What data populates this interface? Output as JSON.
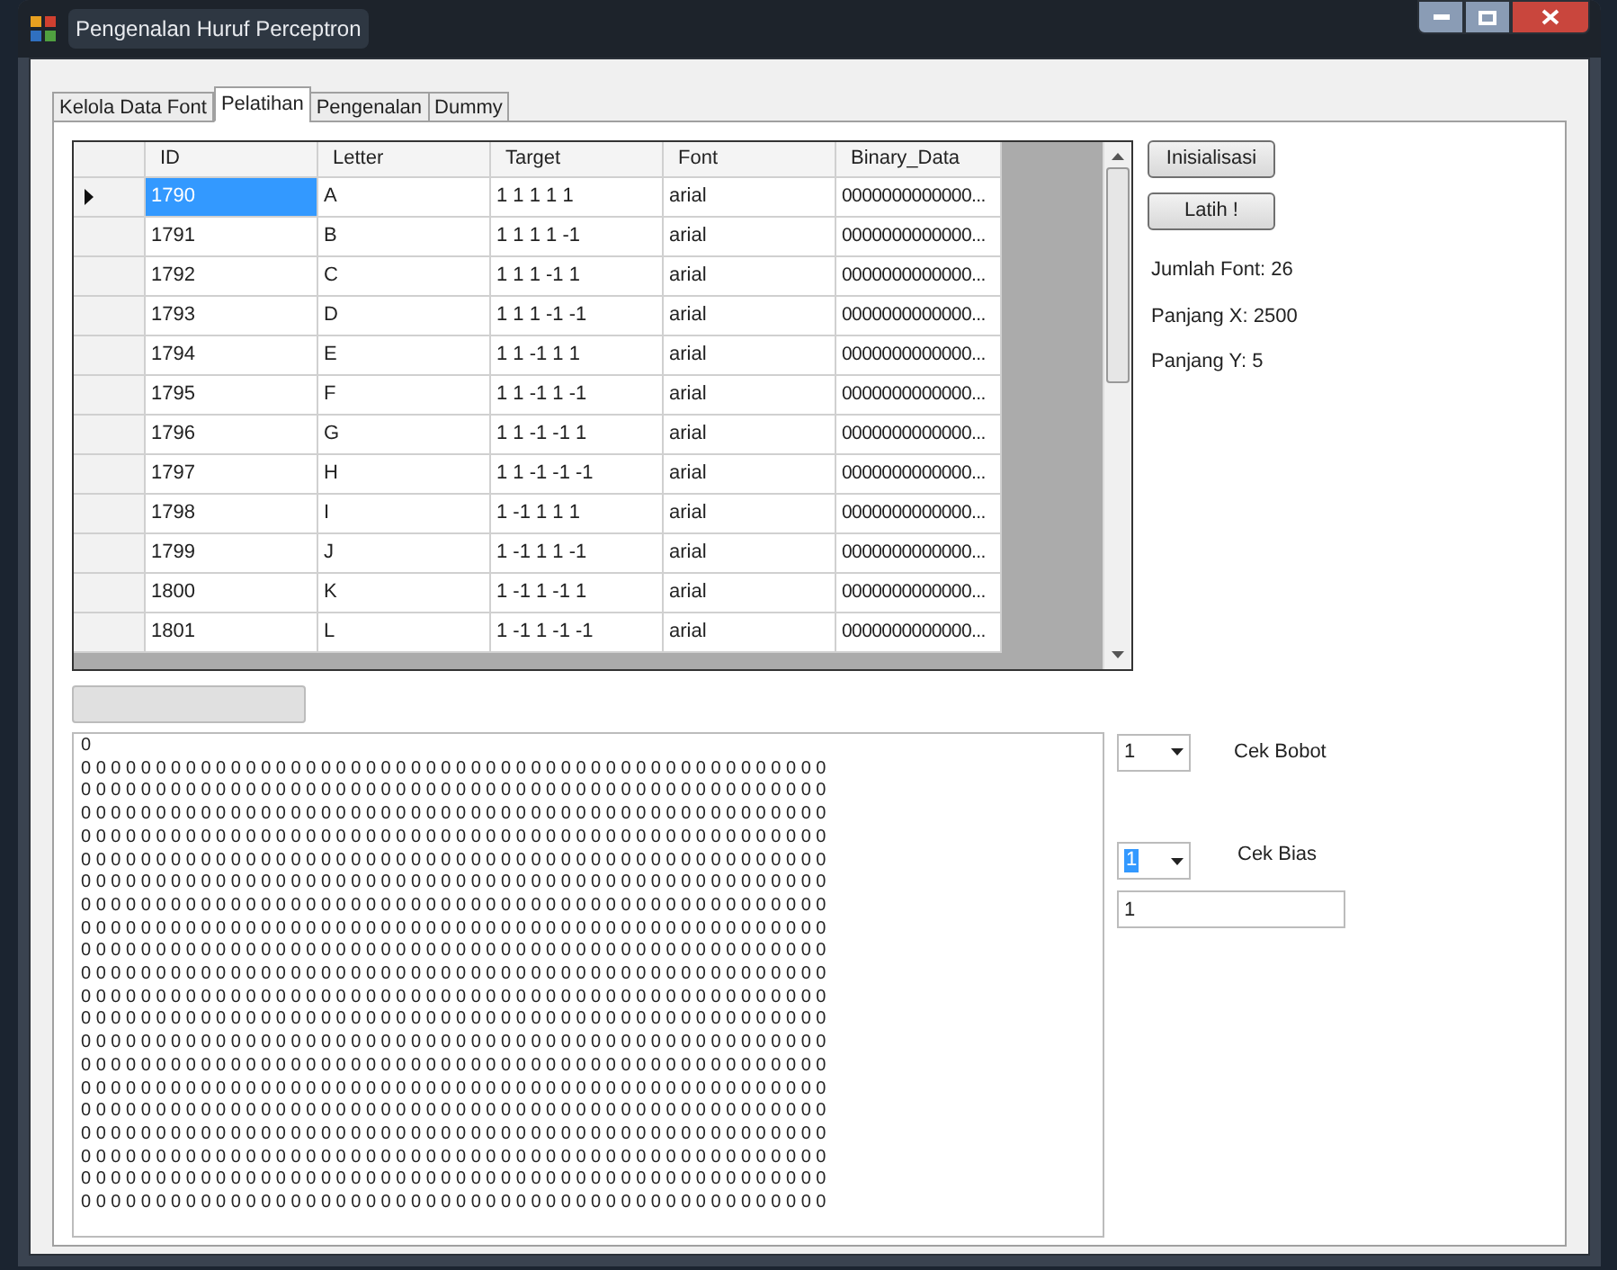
{
  "window": {
    "title": "Pengenalan Huruf Perceptron"
  },
  "tabs": [
    {
      "label": "Kelola Data Font",
      "selected": false
    },
    {
      "label": "Pelatihan",
      "selected": true
    },
    {
      "label": "Pengenalan",
      "selected": false
    },
    {
      "label": "Dummy",
      "selected": false
    }
  ],
  "grid": {
    "columns": [
      "ID",
      "Letter",
      "Target",
      "Font",
      "Binary_Data"
    ],
    "rows": [
      {
        "cells": [
          "1790",
          "A",
          "1 1 1 1 1",
          "arial",
          "0000000000000..."
        ],
        "selected": true
      },
      {
        "cells": [
          "1791",
          "B",
          "1 1 1 1 -1",
          "arial",
          "0000000000000..."
        ],
        "selected": false
      },
      {
        "cells": [
          "1792",
          "C",
          "1 1 1 -1 1",
          "arial",
          "0000000000000..."
        ],
        "selected": false
      },
      {
        "cells": [
          "1793",
          "D",
          "1 1 1 -1 -1",
          "arial",
          "0000000000000..."
        ],
        "selected": false
      },
      {
        "cells": [
          "1794",
          "E",
          "1 1 -1 1 1",
          "arial",
          "0000000000000..."
        ],
        "selected": false
      },
      {
        "cells": [
          "1795",
          "F",
          "1 1 -1 1 -1",
          "arial",
          "0000000000000..."
        ],
        "selected": false
      },
      {
        "cells": [
          "1796",
          "G",
          "1 1 -1 -1 1",
          "arial",
          "0000000000000..."
        ],
        "selected": false
      },
      {
        "cells": [
          "1797",
          "H",
          "1 1 -1 -1 -1",
          "arial",
          "0000000000000..."
        ],
        "selected": false
      },
      {
        "cells": [
          "1798",
          "I",
          "1 -1 1 1 1",
          "arial",
          "0000000000000..."
        ],
        "selected": false
      },
      {
        "cells": [
          "1799",
          "J",
          "1 -1 1 1 -1",
          "arial",
          "0000000000000..."
        ],
        "selected": false
      },
      {
        "cells": [
          "1800",
          "K",
          "1 -1 1 -1 1",
          "arial",
          "0000000000000..."
        ],
        "selected": false
      },
      {
        "cells": [
          "1801",
          "L",
          "1 -1 1 -1 -1",
          "arial",
          "0000000000000..."
        ],
        "selected": false
      }
    ]
  },
  "buttons": [
    "Inisialisasi",
    "Latih !"
  ],
  "info": [
    "Jumlah Font: 26",
    "Panjang X: 2500",
    "Panjang Y: 5"
  ],
  "progress": {
    "level": 0
  },
  "output": {
    "lines": [
      "0",
      "0 0 0 0 0 0 0 0 0 0 0 0 0 0 0 0 0 0 0 0 0 0 0 0 0 0 0 0 0 0 0 0 0 0 0 0 0 0 0 0 0 0 0 0 0 0 0 0 0 0",
      "0 0 0 0 0 0 0 0 0 0 0 0 0 0 0 0 0 0 0 0 0 0 0 0 0 0 0 0 0 0 0 0 0 0 0 0 0 0 0 0 0 0 0 0 0 0 0 0 0 0",
      "0 0 0 0 0 0 0 0 0 0 0 0 0 0 0 0 0 0 0 0 0 0 0 0 0 0 0 0 0 0 0 0 0 0 0 0 0 0 0 0 0 0 0 0 0 0 0 0 0 0",
      "0 0 0 0 0 0 0 0 0 0 0 0 0 0 0 0 0 0 0 0 0 0 0 0 0 0 0 0 0 0 0 0 0 0 0 0 0 0 0 0 0 0 0 0 0 0 0 0 0 0",
      "0 0 0 0 0 0 0 0 0 0 0 0 0 0 0 0 0 0 0 0 0 0 0 0 0 0 0 0 0 0 0 0 0 0 0 0 0 0 0 0 0 0 0 0 0 0 0 0 0 0",
      "0 0 0 0 0 0 0 0 0 0 0 0 0 0 0 0 0 0 0 0 0 0 0 0 0 0 0 0 0 0 0 0 0 0 0 0 0 0 0 0 0 0 0 0 0 0 0 0 0 0",
      "0 0 0 0 0 0 0 0 0 0 0 0 0 0 0 0 0 0 0 0 0 0 0 0 0 0 0 0 0 0 0 0 0 0 0 0 0 0 0 0 0 0 0 0 0 0 0 0 0 0",
      "0 0 0 0 0 0 0 0 0 0 0 0 0 0 0 0 0 0 0 0 0 0 0 0 0 0 0 0 0 0 0 0 0 0 0 0 0 0 0 0 0 0 0 0 0 0 0 0 0 0",
      "0 0 0 0 0 0 0 0 0 0 0 0 0 0 0 0 0 0 0 0 0 0 0 0 0 0 0 0 0 0 0 0 0 0 0 0 0 0 0 0 0 0 0 0 0 0 0 0 0 0",
      "0 0 0 0 0 0 0 0 0 0 0 0 0 0 0 0 0 0 0 0 0 0 0 0 0 0 0 0 0 0 0 0 0 0 0 0 0 0 0 0 0 0 0 0 0 0 0 0 0 0",
      "0 0 0 0 0 0 0 0 0 0 0 0 0 0 0 0 0 0 0 0 0 0 0 0 0 0 0 0 0 0 0 0 0 0 0 0 0 0 0 0 0 0 0 0 0 0 0 0 0 0",
      "0 0 0 0 0 0 0 0 0 0 0 0 0 0 0 0 0 0 0 0 0 0 0 0 0 0 0 0 0 0 0 0 0 0 0 0 0 0 0 0 0 0 0 0 0 0 0 0 0 0",
      "0 0 0 0 0 0 0 0 0 0 0 0 0 0 0 0 0 0 0 0 0 0 0 0 0 0 0 0 0 0 0 0 0 0 0 0 0 0 0 0 0 0 0 0 0 0 0 0 0 0",
      "0 0 0 0 0 0 0 0 0 0 0 0 0 0 0 0 0 0 0 0 0 0 0 0 0 0 0 0 0 0 0 0 0 0 0 0 0 0 0 0 0 0 0 0 0 0 0 0 0 0",
      "0 0 0 0 0 0 0 0 0 0 0 0 0 0 0 0 0 0 0 0 0 0 0 0 0 0 0 0 0 0 0 0 0 0 0 0 0 0 0 0 0 0 0 0 0 0 0 0 0 0",
      "0 0 0 0 0 0 0 0 0 0 0 0 0 0 0 0 0 0 0 0 0 0 0 0 0 0 0 0 0 0 0 0 0 0 0 0 0 0 0 0 0 0 0 0 0 0 0 0 0 0",
      "0 0 0 0 0 0 0 0 0 0 0 0 0 0 0 0 0 0 0 0 0 0 0 0 0 0 0 0 0 0 0 0 0 0 0 0 0 0 0 0 0 0 0 0 0 0 0 0 0 0",
      "0 0 0 0 0 0 0 0 0 0 0 0 0 0 0 0 0 0 0 0 0 0 0 0 0 0 0 0 0 0 0 0 0 0 0 0 0 0 0 0 0 0 0 0 0 0 0 0 0 0",
      "0 0 0 0 0 0 0 0 0 0 0 0 0 0 0 0 0 0 0 0 0 0 0 0 0 0 0 0 0 0 0 0 0 0 0 0 0 0 0 0 0 0 0 0 0 0 0 0 0 0",
      "0 0 0 0 0 0 0 0 0 0 0 0 0 0 0 0 0 0 0 0 0 0 0 0 0 0 0 0 0 0 0 0 0 0 0 0 0 0 0 0 0 0 0 0 0 0 0 0 0 0"
    ]
  },
  "weight_check": {
    "value": "1",
    "label": "Cek Bobot"
  },
  "bias_check": {
    "value": "1",
    "label": "Cek Bias",
    "highlighted": true
  },
  "bias_field": {
    "value": "1"
  }
}
